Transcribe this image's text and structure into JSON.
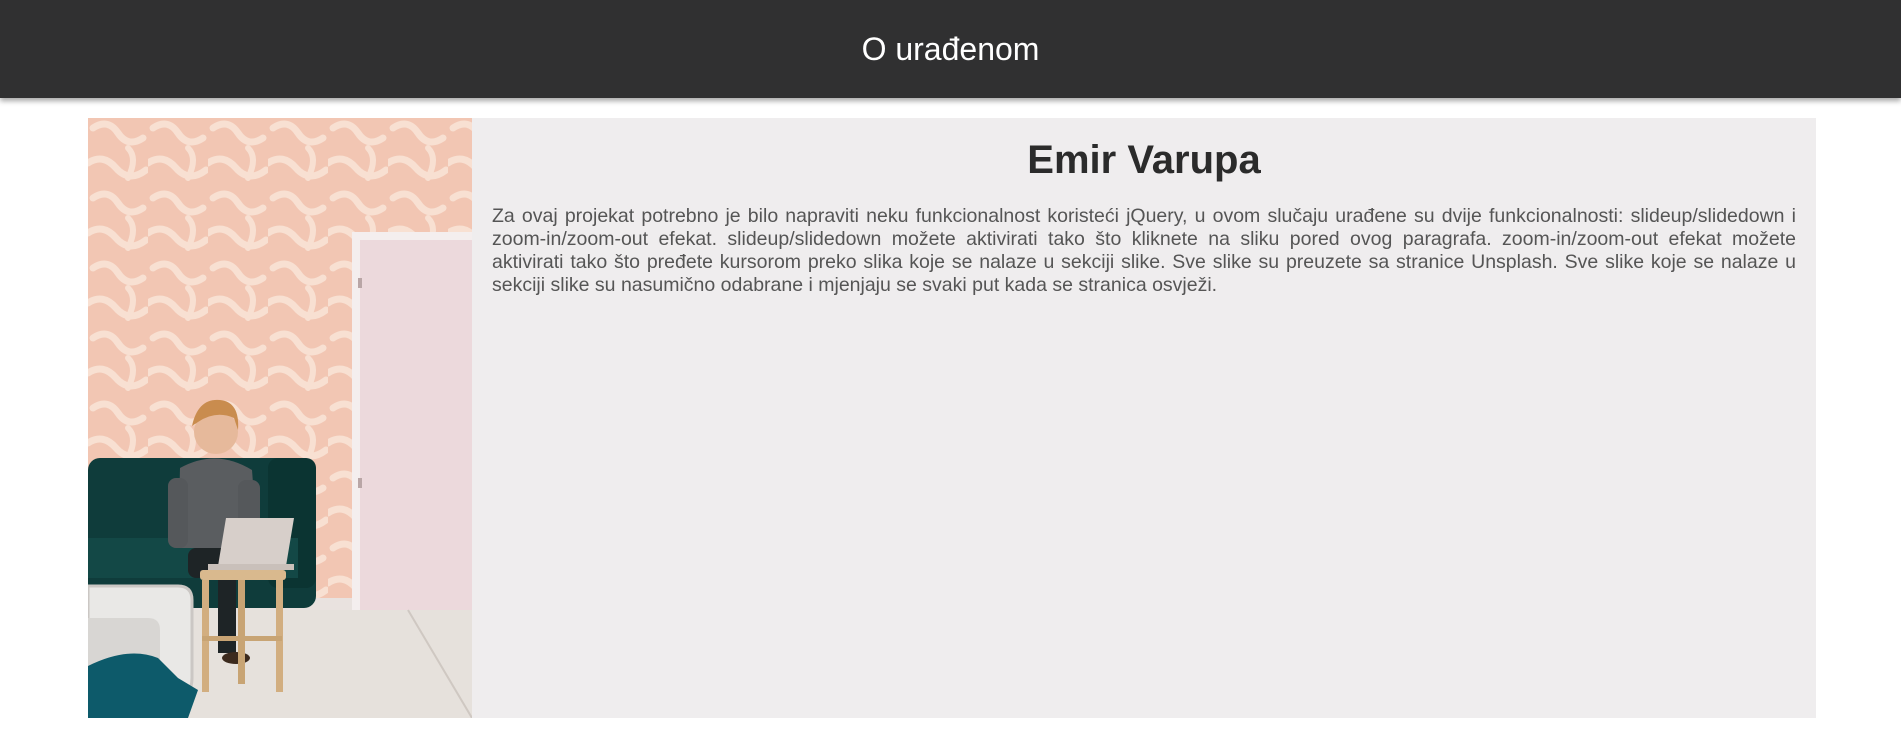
{
  "header": {
    "title": "O urađenom"
  },
  "profile": {
    "name": "Emir Varupa",
    "description": "Za ovaj projekat potrebno je bilo napraviti neku funkcionalnost koristeći jQuery, u ovom slučaju urađene su dvije funkcionalnosti: slideup/slidedown i zoom-in/zoom-out efekat. slideup/slidedown možete aktivirati tako što kliknete na sliku pored ovog paragrafa. zoom-in/zoom-out efekat možete aktivirati tako što pređete kursorom preko slika koje se nalaze u sekciji slike. Sve slike su preuzete sa stranice Unsplash. Sve slike koje se nalaze u sekciji slike su nasumično odabrane i mjenjaju se svaki put kada se stranica osvježi.",
    "photo": "man-with-laptop-on-couch-photo"
  },
  "colors": {
    "header_bg": "#303031",
    "card_bg": "#efedee",
    "title_text": "#2b2b2b",
    "body_text": "#555555"
  }
}
